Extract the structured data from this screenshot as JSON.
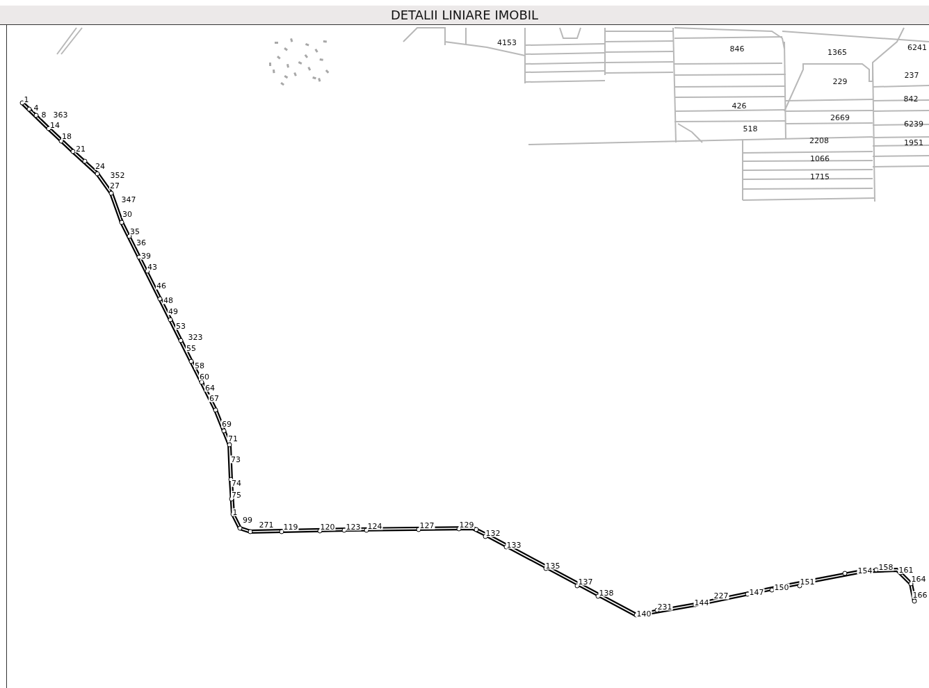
{
  "title": "DETALII LINIARE IMOBIL",
  "map": {
    "parcel_numbers": [
      "4153",
      "846",
      "1365",
      "6241",
      "237",
      "229",
      "842",
      "426",
      "2669",
      "6239",
      "518",
      "2208",
      "1951",
      "1066",
      "1715"
    ],
    "point_labels": [
      "1",
      "4",
      "8",
      "363",
      "14",
      "18",
      "21",
      "24",
      "352",
      "27",
      "347",
      "30",
      "35",
      "36",
      "39",
      "43",
      "46",
      "48",
      "49",
      "53",
      "323",
      "55",
      "58",
      "60",
      "64",
      "67",
      "69",
      "71",
      "73",
      "74",
      "75",
      "1",
      "99",
      "271",
      "119",
      "120",
      "123",
      "124",
      "127",
      "129",
      "132",
      "133",
      "135",
      "137",
      "138",
      "140",
      "231",
      "144",
      "227",
      "147",
      "150",
      "151",
      "154",
      "158",
      "161",
      "164",
      "166"
    ]
  }
}
